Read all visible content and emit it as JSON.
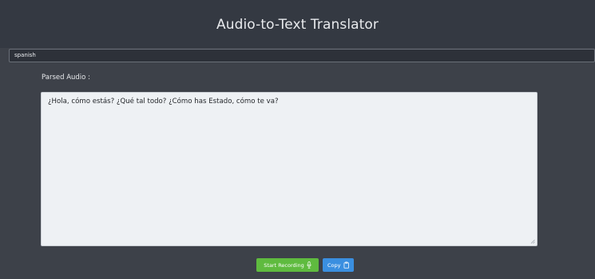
{
  "header": {
    "title": "Audio-to-Text Translator"
  },
  "language_select": {
    "selected": "spanish"
  },
  "transcript": {
    "label": "Parsed Audio :",
    "value": "¿Hola, cómo estás? ¿Qué tal todo? ¿Cómo has Estado, cómo te va?"
  },
  "actions": {
    "record_label": "Start Recording",
    "record_icon": "microphone-icon",
    "copy_label": "Copy",
    "copy_icon": "clipboard-icon"
  },
  "colors": {
    "background": "#3d4149",
    "header_bg": "#343942",
    "record_button": "#5fbb3f",
    "copy_button": "#3a8fe0"
  }
}
